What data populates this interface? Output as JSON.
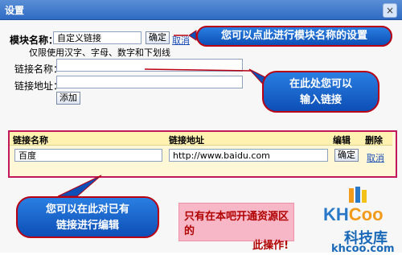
{
  "window": {
    "title": "设置",
    "close_icon": "close-icon"
  },
  "module": {
    "label": "模块名称：",
    "value": "自定义链接",
    "confirm": "确定",
    "cancel": "取消",
    "hint": "仅限使用汉字、字母、数字和下划线"
  },
  "link_form": {
    "name_label": "链接名称：",
    "addr_label": "链接地址：",
    "add_button": "添加"
  },
  "table": {
    "headers": [
      "链接名称",
      "链接地址",
      "编辑",
      "删除"
    ],
    "row": {
      "name": "百度",
      "url": "http://www.baidu.com",
      "confirm": "确定",
      "cancel": "取消"
    }
  },
  "callouts": {
    "module": "您可以点此进行模块名称的设置",
    "input_line1": "在此处您可以",
    "input_line2": "输入链接",
    "edit_line1": "您可以在此对已有",
    "edit_line2": "链接进行编辑"
  },
  "note": {
    "line1": "只有在本吧开通资源区的",
    "line2": "此操作!"
  },
  "watermark": {
    "brand_kh": "KH",
    "brand_coo": "Coo",
    "cn": "科技库",
    "domain": "khcoo.com"
  },
  "colors": {
    "title_bar": "#2f6bc4",
    "callout_blue": "#0d4fb6",
    "callout_border": "#b80012",
    "table_border": "#c2185b",
    "note_bg": "#f7b7c7"
  }
}
